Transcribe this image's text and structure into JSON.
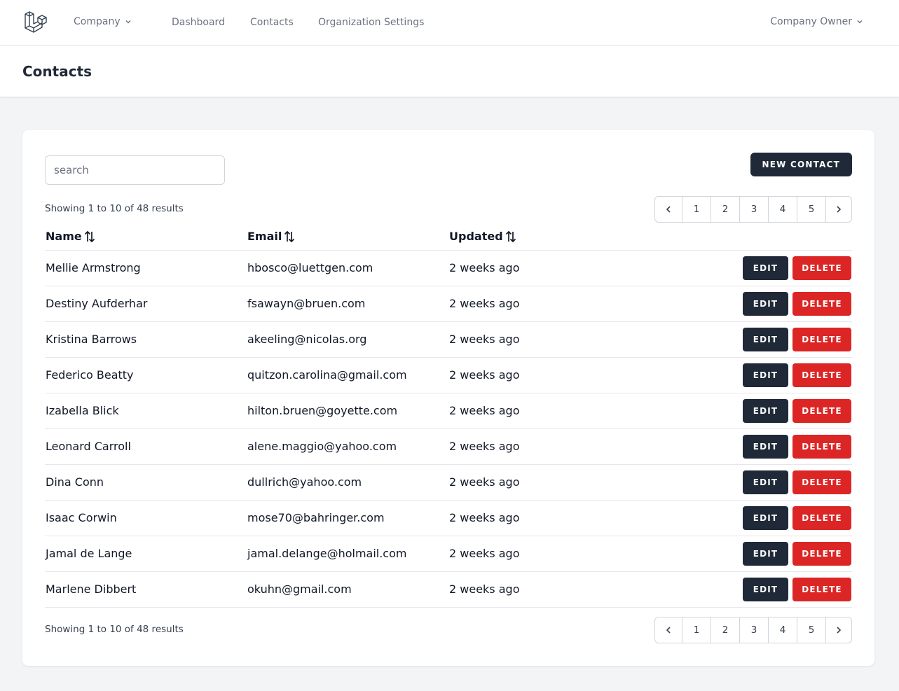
{
  "nav": {
    "team": "Company",
    "links": [
      "Dashboard",
      "Contacts",
      "Organization Settings"
    ],
    "user": "Company Owner"
  },
  "header": {
    "title": "Contacts"
  },
  "search": {
    "placeholder": "search",
    "value": ""
  },
  "new_contact_label": "NEW CONTACT",
  "showing": "Showing 1 to 10 of 48 results",
  "pagination": {
    "pages": [
      "1",
      "2",
      "3",
      "4",
      "5"
    ]
  },
  "table": {
    "columns": [
      "Name",
      "Email",
      "Updated"
    ],
    "edit_label": "EDIT",
    "delete_label": "DELETE",
    "rows": [
      {
        "name": "Mellie Armstrong",
        "email": "hbosco@luettgen.com",
        "updated": "2 weeks ago"
      },
      {
        "name": "Destiny Aufderhar",
        "email": "fsawayn@bruen.com",
        "updated": "2 weeks ago"
      },
      {
        "name": "Kristina Barrows",
        "email": "akeeling@nicolas.org",
        "updated": "2 weeks ago"
      },
      {
        "name": "Federico Beatty",
        "email": "quitzon.carolina@gmail.com",
        "updated": "2 weeks ago"
      },
      {
        "name": "Izabella Blick",
        "email": "hilton.bruen@goyette.com",
        "updated": "2 weeks ago"
      },
      {
        "name": "Leonard Carroll",
        "email": "alene.maggio@yahoo.com",
        "updated": "2 weeks ago"
      },
      {
        "name": "Dina Conn",
        "email": "dullrich@yahoo.com",
        "updated": "2 weeks ago"
      },
      {
        "name": "Isaac Corwin",
        "email": "mose70@bahringer.com",
        "updated": "2 weeks ago"
      },
      {
        "name": "Jamal de Lange",
        "email": "jamal.delange@holmail.com",
        "updated": "2 weeks ago"
      },
      {
        "name": "Marlene Dibbert",
        "email": "okuhn@gmail.com",
        "updated": "2 weeks ago"
      }
    ]
  },
  "colors": {
    "dark": "#1f2937",
    "danger": "#dc2626",
    "background": "#f3f4f6"
  },
  "icons": {
    "logo": "laravel-logo-icon",
    "dropdown": "chevron-down-icon",
    "sort": "sort-arrows-icon",
    "prev": "chevron-left-icon",
    "next": "chevron-right-icon"
  }
}
